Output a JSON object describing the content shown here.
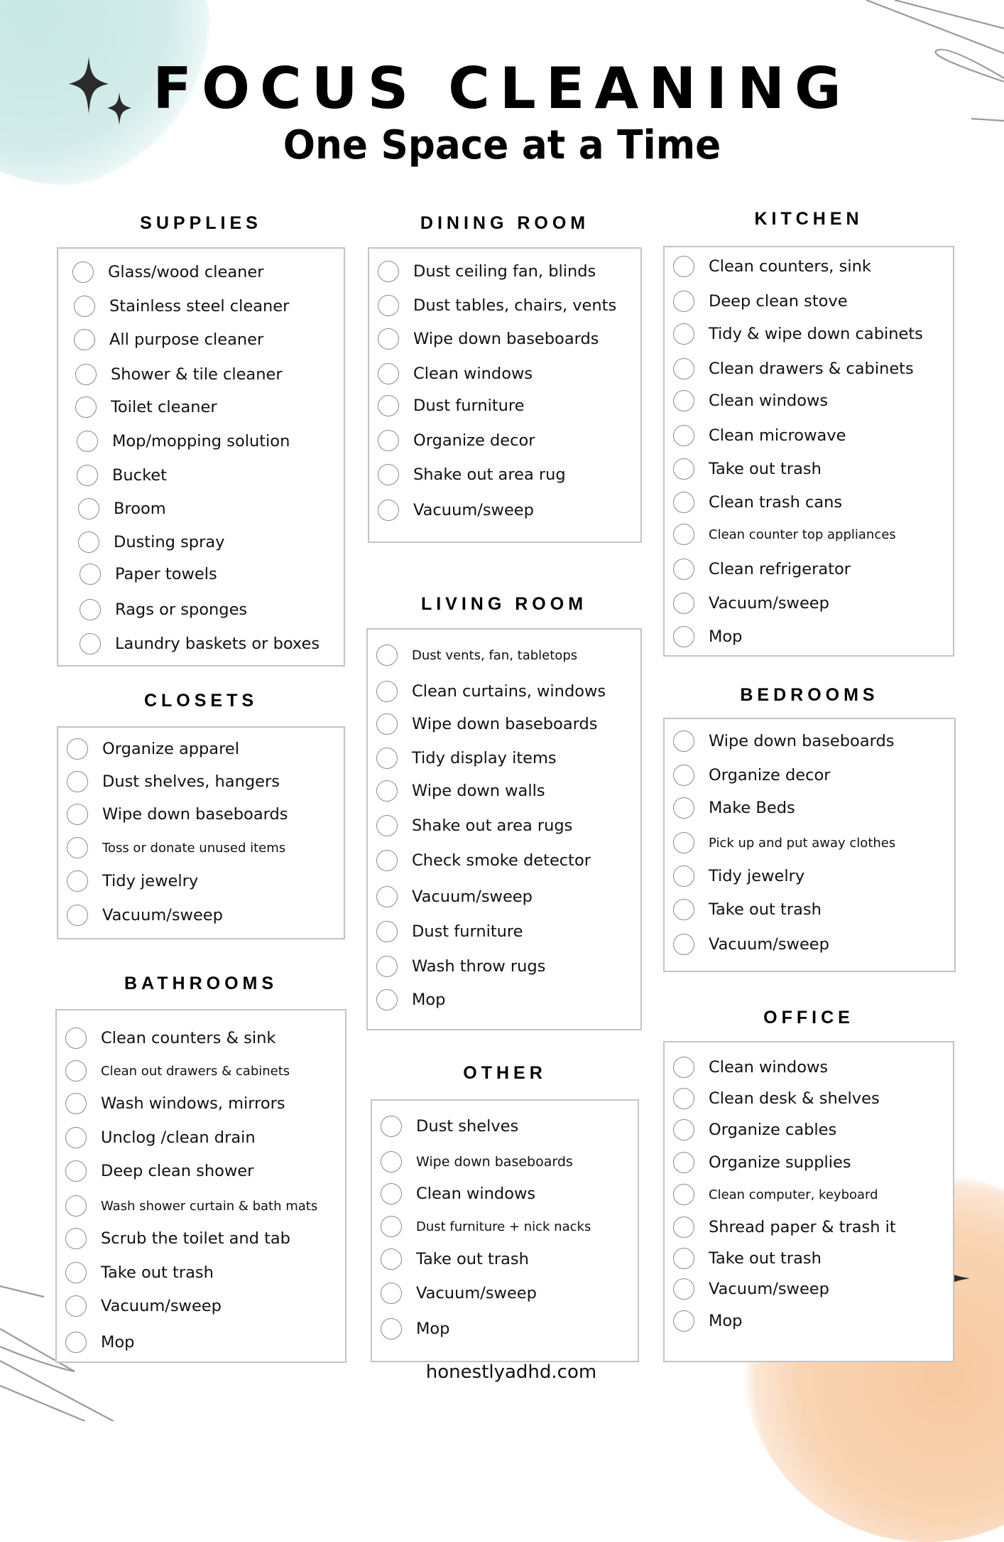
{
  "header": {
    "title": "FOCUS CLEANING",
    "subtitle": "One Space at a Time"
  },
  "colors": {
    "accent_teal": "#c7e6e4",
    "accent_peach": "#f7c9a0",
    "text": "#111111",
    "box_border": "#c4c4c4"
  },
  "sections": {
    "supplies": {
      "title": "SUPPLIES",
      "items": [
        "Glass/wood cleaner",
        "Stainless steel cleaner",
        "All purpose cleaner",
        "Shower & tile cleaner",
        "Toilet cleaner",
        "Mop/mopping solution",
        "Bucket",
        "Broom",
        "Dusting spray",
        "Paper towels",
        "Rags or sponges",
        "Laundry baskets or boxes"
      ]
    },
    "dining_room": {
      "title": "DINING ROOM",
      "items": [
        "Dust ceiling fan, blinds",
        "Dust tables, chairs, vents",
        "Wipe down baseboards",
        "Clean windows",
        "Dust furniture",
        "Organize decor",
        "Shake out area rug",
        "Vacuum/sweep"
      ]
    },
    "kitchen": {
      "title": "KITCHEN",
      "items": [
        "Clean counters, sink",
        "Deep clean stove",
        "Tidy & wipe down cabinets",
        "Clean drawers & cabinets",
        "Clean windows",
        "Clean microwave",
        "Take out trash",
        "Clean trash cans",
        "Clean counter top appliances",
        "Clean refrigerator",
        "Vacuum/sweep",
        "Mop"
      ]
    },
    "closets": {
      "title": "CLOSETS",
      "items": [
        "Organize apparel",
        "Dust shelves, hangers",
        "Wipe down baseboards",
        "Toss or donate unused items",
        "Tidy jewelry",
        "Vacuum/sweep"
      ]
    },
    "living_room": {
      "title": "LIVING ROOM",
      "items": [
        "Dust vents, fan, tabletops",
        "Clean curtains, windows",
        "Wipe down baseboards",
        "Tidy display items",
        "Wipe down walls",
        "Shake out area rugs",
        "Check smoke detector",
        "Vacuum/sweep",
        "Dust furniture",
        "Wash throw rugs",
        "Mop"
      ]
    },
    "bedrooms": {
      "title": "BEDROOMS",
      "items": [
        "Wipe down baseboards",
        "Organize decor",
        "Make Beds",
        "Pick up and put away clothes",
        "Tidy jewelry",
        "Take out trash",
        "Vacuum/sweep"
      ]
    },
    "bathrooms": {
      "title": "BATHROOMS",
      "items": [
        "Clean counters & sink",
        "Clean out drawers & cabinets",
        "Wash windows, mirrors",
        "Unclog /clean drain",
        "Deep clean shower",
        "Wash shower curtain & bath mats",
        "Scrub the toilet and tab",
        "Take out trash",
        "Vacuum/sweep",
        "Mop"
      ]
    },
    "other": {
      "title": "OTHER",
      "items": [
        "Dust shelves",
        "Wipe down baseboards",
        "Clean windows",
        "Dust furniture + nick nacks",
        "Take out trash",
        "Vacuum/sweep",
        "Mop"
      ]
    },
    "office": {
      "title": "OFFICE",
      "items": [
        "Clean windows",
        "Clean desk & shelves",
        "Organize cables",
        "Organize supplies",
        "Clean computer, keyboard",
        "Shread paper & trash it",
        "Take out trash",
        "Vacuum/sweep",
        "Mop"
      ]
    }
  },
  "footer": {
    "website": "honestlyadhd.com"
  },
  "icons": {
    "sparkle": "four-point-star",
    "checkbox": "empty-circle"
  }
}
